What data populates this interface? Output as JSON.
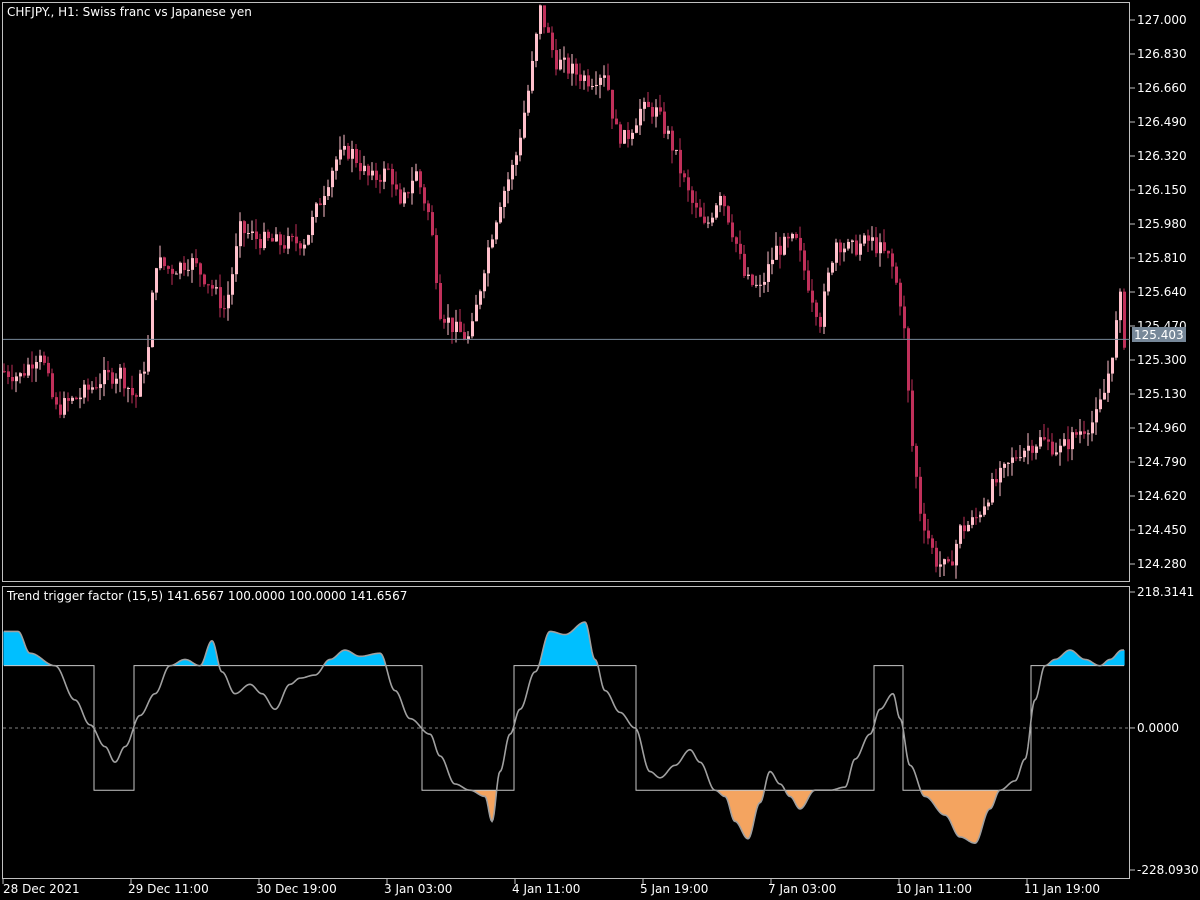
{
  "main_panel": {
    "title": "CHFJPY., H1:  Swiss franc vs Japanese yen",
    "price_ticks": [
      "127.000",
      "126.830",
      "126.660",
      "126.490",
      "126.320",
      "126.150",
      "125.980",
      "125.810",
      "125.640",
      "125.470",
      "125.300",
      "125.130",
      "124.960",
      "124.790",
      "124.620",
      "124.450",
      "124.280"
    ],
    "current_price_label": "125.403"
  },
  "indicator_panel": {
    "title": "Trend trigger factor (15,5) 141.6567 100.0000 100.0000 141.6567",
    "ticks": [
      "218.3141",
      "0.0000",
      "-228.0930"
    ]
  },
  "time_axis": {
    "labels": [
      "28 Dec 2021",
      "29 Dec 11:00",
      "30 Dec 19:00",
      "3 Jan 03:00",
      "4 Jan 11:00",
      "5 Jan 19:00",
      "7 Jan 03:00",
      "10 Jan 11:00",
      "11 Jan 19:00"
    ]
  },
  "colors": {
    "background": "#000000",
    "border": "#c0c0c0",
    "bull_candle": "#ffc0cb",
    "bear_candle": "#c0305a",
    "bid_line": "#778899",
    "ttf_line": "#a0a0a0",
    "trigger_line": "#c8c8c8",
    "positive_fill": "#00bfff",
    "negative_fill": "#f4a460",
    "negative_edge": "#ff4500"
  },
  "chart_data": {
    "type": "candlestick",
    "symbol": "CHFJPY.",
    "timeframe": "H1",
    "ylim": [
      124.2,
      127.08
    ],
    "close_path": [
      [
        0,
        125.25
      ],
      [
        20,
        125.22
      ],
      [
        40,
        125.35
      ],
      [
        55,
        125.05
      ],
      [
        80,
        125.12
      ],
      [
        100,
        125.2
      ],
      [
        120,
        125.24
      ],
      [
        135,
        125.1
      ],
      [
        148,
        125.35
      ],
      [
        155,
        125.8
      ],
      [
        170,
        125.75
      ],
      [
        190,
        125.8
      ],
      [
        210,
        125.68
      ],
      [
        225,
        125.55
      ],
      [
        240,
        125.95
      ],
      [
        260,
        125.9
      ],
      [
        285,
        125.88
      ],
      [
        305,
        125.9
      ],
      [
        320,
        126.1
      ],
      [
        335,
        126.3
      ],
      [
        350,
        126.35
      ],
      [
        370,
        126.2
      ],
      [
        390,
        126.25
      ],
      [
        400,
        126.05
      ],
      [
        415,
        126.25
      ],
      [
        430,
        126.0
      ],
      [
        440,
        125.55
      ],
      [
        455,
        125.45
      ],
      [
        470,
        125.4
      ],
      [
        485,
        125.8
      ],
      [
        500,
        126.1
      ],
      [
        515,
        126.3
      ],
      [
        530,
        126.7
      ],
      [
        540,
        127.05
      ],
      [
        555,
        126.8
      ],
      [
        570,
        126.75
      ],
      [
        590,
        126.7
      ],
      [
        605,
        126.75
      ],
      [
        615,
        126.45
      ],
      [
        625,
        126.4
      ],
      [
        640,
        126.55
      ],
      [
        655,
        126.55
      ],
      [
        670,
        126.4
      ],
      [
        690,
        126.1
      ],
      [
        705,
        125.95
      ],
      [
        720,
        126.15
      ],
      [
        735,
        125.9
      ],
      [
        745,
        125.7
      ],
      [
        760,
        125.65
      ],
      [
        775,
        125.85
      ],
      [
        795,
        125.9
      ],
      [
        810,
        125.65
      ],
      [
        820,
        125.5
      ],
      [
        835,
        125.9
      ],
      [
        850,
        125.85
      ],
      [
        870,
        125.9
      ],
      [
        890,
        125.8
      ],
      [
        900,
        125.6
      ],
      [
        905,
        125.4
      ],
      [
        910,
        124.95
      ],
      [
        920,
        124.55
      ],
      [
        935,
        124.3
      ],
      [
        948,
        124.25
      ],
      [
        960,
        124.45
      ],
      [
        975,
        124.5
      ],
      [
        990,
        124.65
      ],
      [
        1005,
        124.75
      ],
      [
        1020,
        124.85
      ],
      [
        1040,
        124.9
      ],
      [
        1060,
        124.85
      ],
      [
        1080,
        124.95
      ],
      [
        1095,
        125.0
      ],
      [
        1105,
        125.15
      ],
      [
        1112,
        125.35
      ],
      [
        1120,
        125.6
      ],
      [
        1124,
        125.4
      ]
    ],
    "bid_price": 125.403
  },
  "ttf_data": {
    "ylim": [
      -228.093,
      218.3141
    ],
    "trigger_levels": [
      100,
      -100
    ],
    "zero_level": 0,
    "values": [
      [
        0,
        155
      ],
      [
        18,
        155
      ],
      [
        30,
        120
      ],
      [
        55,
        100
      ],
      [
        75,
        45
      ],
      [
        90,
        5
      ],
      [
        105,
        -30
      ],
      [
        115,
        -55
      ],
      [
        125,
        -30
      ],
      [
        140,
        20
      ],
      [
        155,
        55
      ],
      [
        170,
        100
      ],
      [
        185,
        110
      ],
      [
        200,
        100
      ],
      [
        212,
        140
      ],
      [
        222,
        90
      ],
      [
        235,
        55
      ],
      [
        250,
        70
      ],
      [
        262,
        55
      ],
      [
        275,
        30
      ],
      [
        290,
        70
      ],
      [
        300,
        80
      ],
      [
        315,
        85
      ],
      [
        330,
        110
      ],
      [
        345,
        125
      ],
      [
        360,
        115
      ],
      [
        380,
        120
      ],
      [
        395,
        60
      ],
      [
        410,
        15
      ],
      [
        430,
        -10
      ],
      [
        440,
        -45
      ],
      [
        455,
        -90
      ],
      [
        470,
        -100
      ],
      [
        485,
        -110
      ],
      [
        492,
        -150
      ],
      [
        500,
        -70
      ],
      [
        510,
        -10
      ],
      [
        520,
        30
      ],
      [
        535,
        90
      ],
      [
        550,
        155
      ],
      [
        565,
        150
      ],
      [
        585,
        170
      ],
      [
        595,
        110
      ],
      [
        605,
        60
      ],
      [
        620,
        25
      ],
      [
        635,
        0
      ],
      [
        650,
        -70
      ],
      [
        660,
        -80
      ],
      [
        675,
        -60
      ],
      [
        690,
        -35
      ],
      [
        700,
        -55
      ],
      [
        715,
        -100
      ],
      [
        725,
        -110
      ],
      [
        735,
        -150
      ],
      [
        748,
        -178
      ],
      [
        760,
        -120
      ],
      [
        770,
        -70
      ],
      [
        780,
        -90
      ],
      [
        790,
        -110
      ],
      [
        800,
        -130
      ],
      [
        815,
        -100
      ],
      [
        830,
        -100
      ],
      [
        845,
        -95
      ],
      [
        855,
        -50
      ],
      [
        870,
        -10
      ],
      [
        880,
        30
      ],
      [
        893,
        55
      ],
      [
        900,
        15
      ],
      [
        910,
        -60
      ],
      [
        925,
        -110
      ],
      [
        945,
        -140
      ],
      [
        960,
        -175
      ],
      [
        975,
        -185
      ],
      [
        990,
        -130
      ],
      [
        1000,
        -100
      ],
      [
        1015,
        -85
      ],
      [
        1025,
        -50
      ],
      [
        1035,
        45
      ],
      [
        1045,
        100
      ],
      [
        1055,
        110
      ],
      [
        1070,
        125
      ],
      [
        1085,
        110
      ],
      [
        1100,
        100
      ],
      [
        1110,
        110
      ],
      [
        1122,
        125
      ]
    ]
  }
}
